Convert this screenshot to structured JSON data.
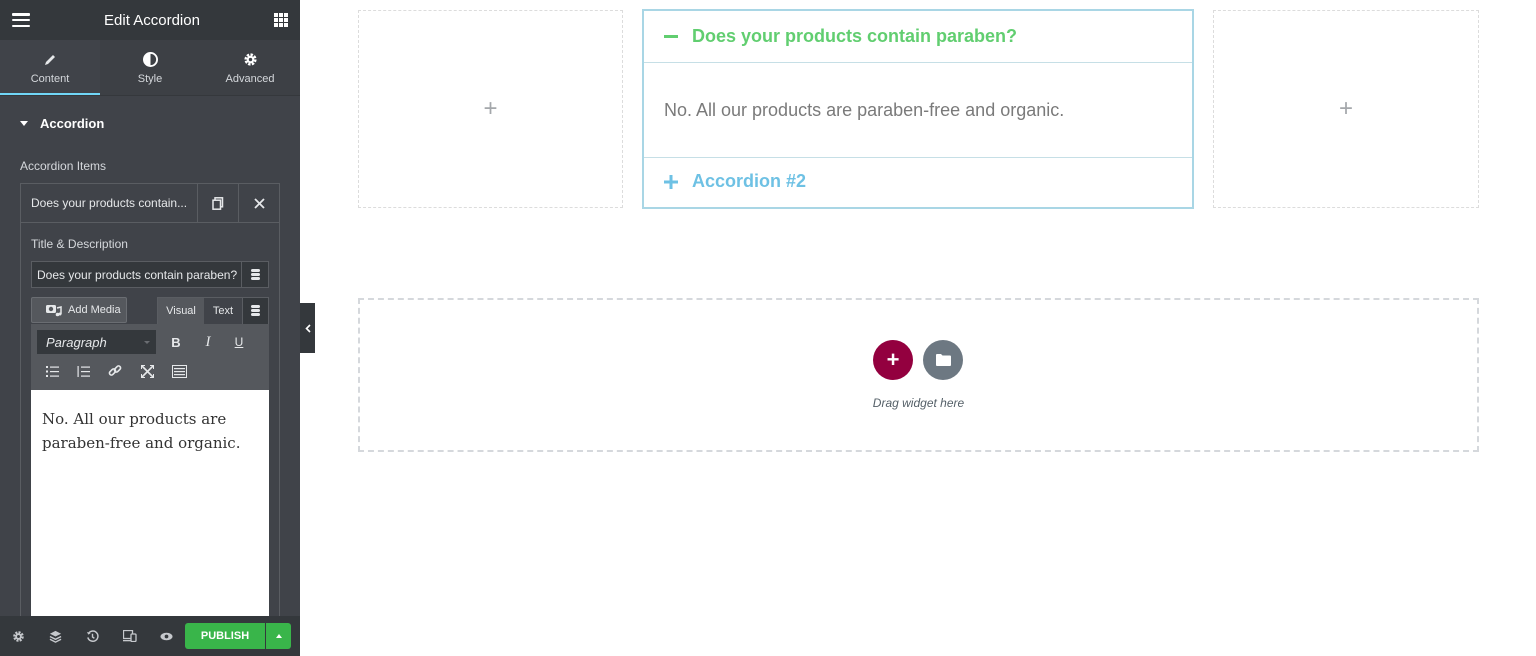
{
  "panel": {
    "header": {
      "title": "Edit Accordion",
      "menu_icon": "hamburger-icon",
      "widgets_icon": "grid-icon"
    },
    "tabs": [
      {
        "label": "Content",
        "icon": "pencil-icon",
        "active": true
      },
      {
        "label": "Style",
        "icon": "half-circle-icon",
        "active": false
      },
      {
        "label": "Advanced",
        "icon": "gear-icon",
        "active": false
      }
    ],
    "section": {
      "label": "Accordion"
    },
    "items_label": "Accordion Items",
    "repeater": {
      "item_title": "Does your products contain...",
      "duplicate_icon": "copy-icon",
      "remove_icon": "close-icon",
      "field_label": "Title & Description",
      "title_value": "Does your products contain paraben?",
      "add_media_label": "Add Media",
      "mode_tabs": {
        "visual": "Visual",
        "text": "Text"
      },
      "format_select": "Paragraph",
      "toolbar": {
        "bold": "B",
        "italic": "I",
        "underline": "U"
      },
      "editor_text": "No. All our products are paraben-free and organic."
    },
    "footer": {
      "publish_label": "PUBLISH"
    }
  },
  "canvas": {
    "accordion": {
      "items": [
        {
          "title": "Does your products contain paraben?",
          "content": "No. All our products are paraben-free and organic.",
          "expanded": true,
          "icon": "minus-icon"
        },
        {
          "title": "Accordion #2",
          "expanded": false,
          "icon": "plus-icon"
        }
      ],
      "colors": {
        "active_title": "#61ce70",
        "title": "#6ec1e4",
        "content": "#7a7a7a",
        "border": "#a9d6e5"
      }
    },
    "empty_column_glyph": "+",
    "drop_zone": {
      "text": "Drag widget here",
      "add_glyph": "+"
    },
    "colors": {
      "add_button": "#93003f",
      "template_button": "#6d7882",
      "publish": "#39b54a"
    }
  }
}
